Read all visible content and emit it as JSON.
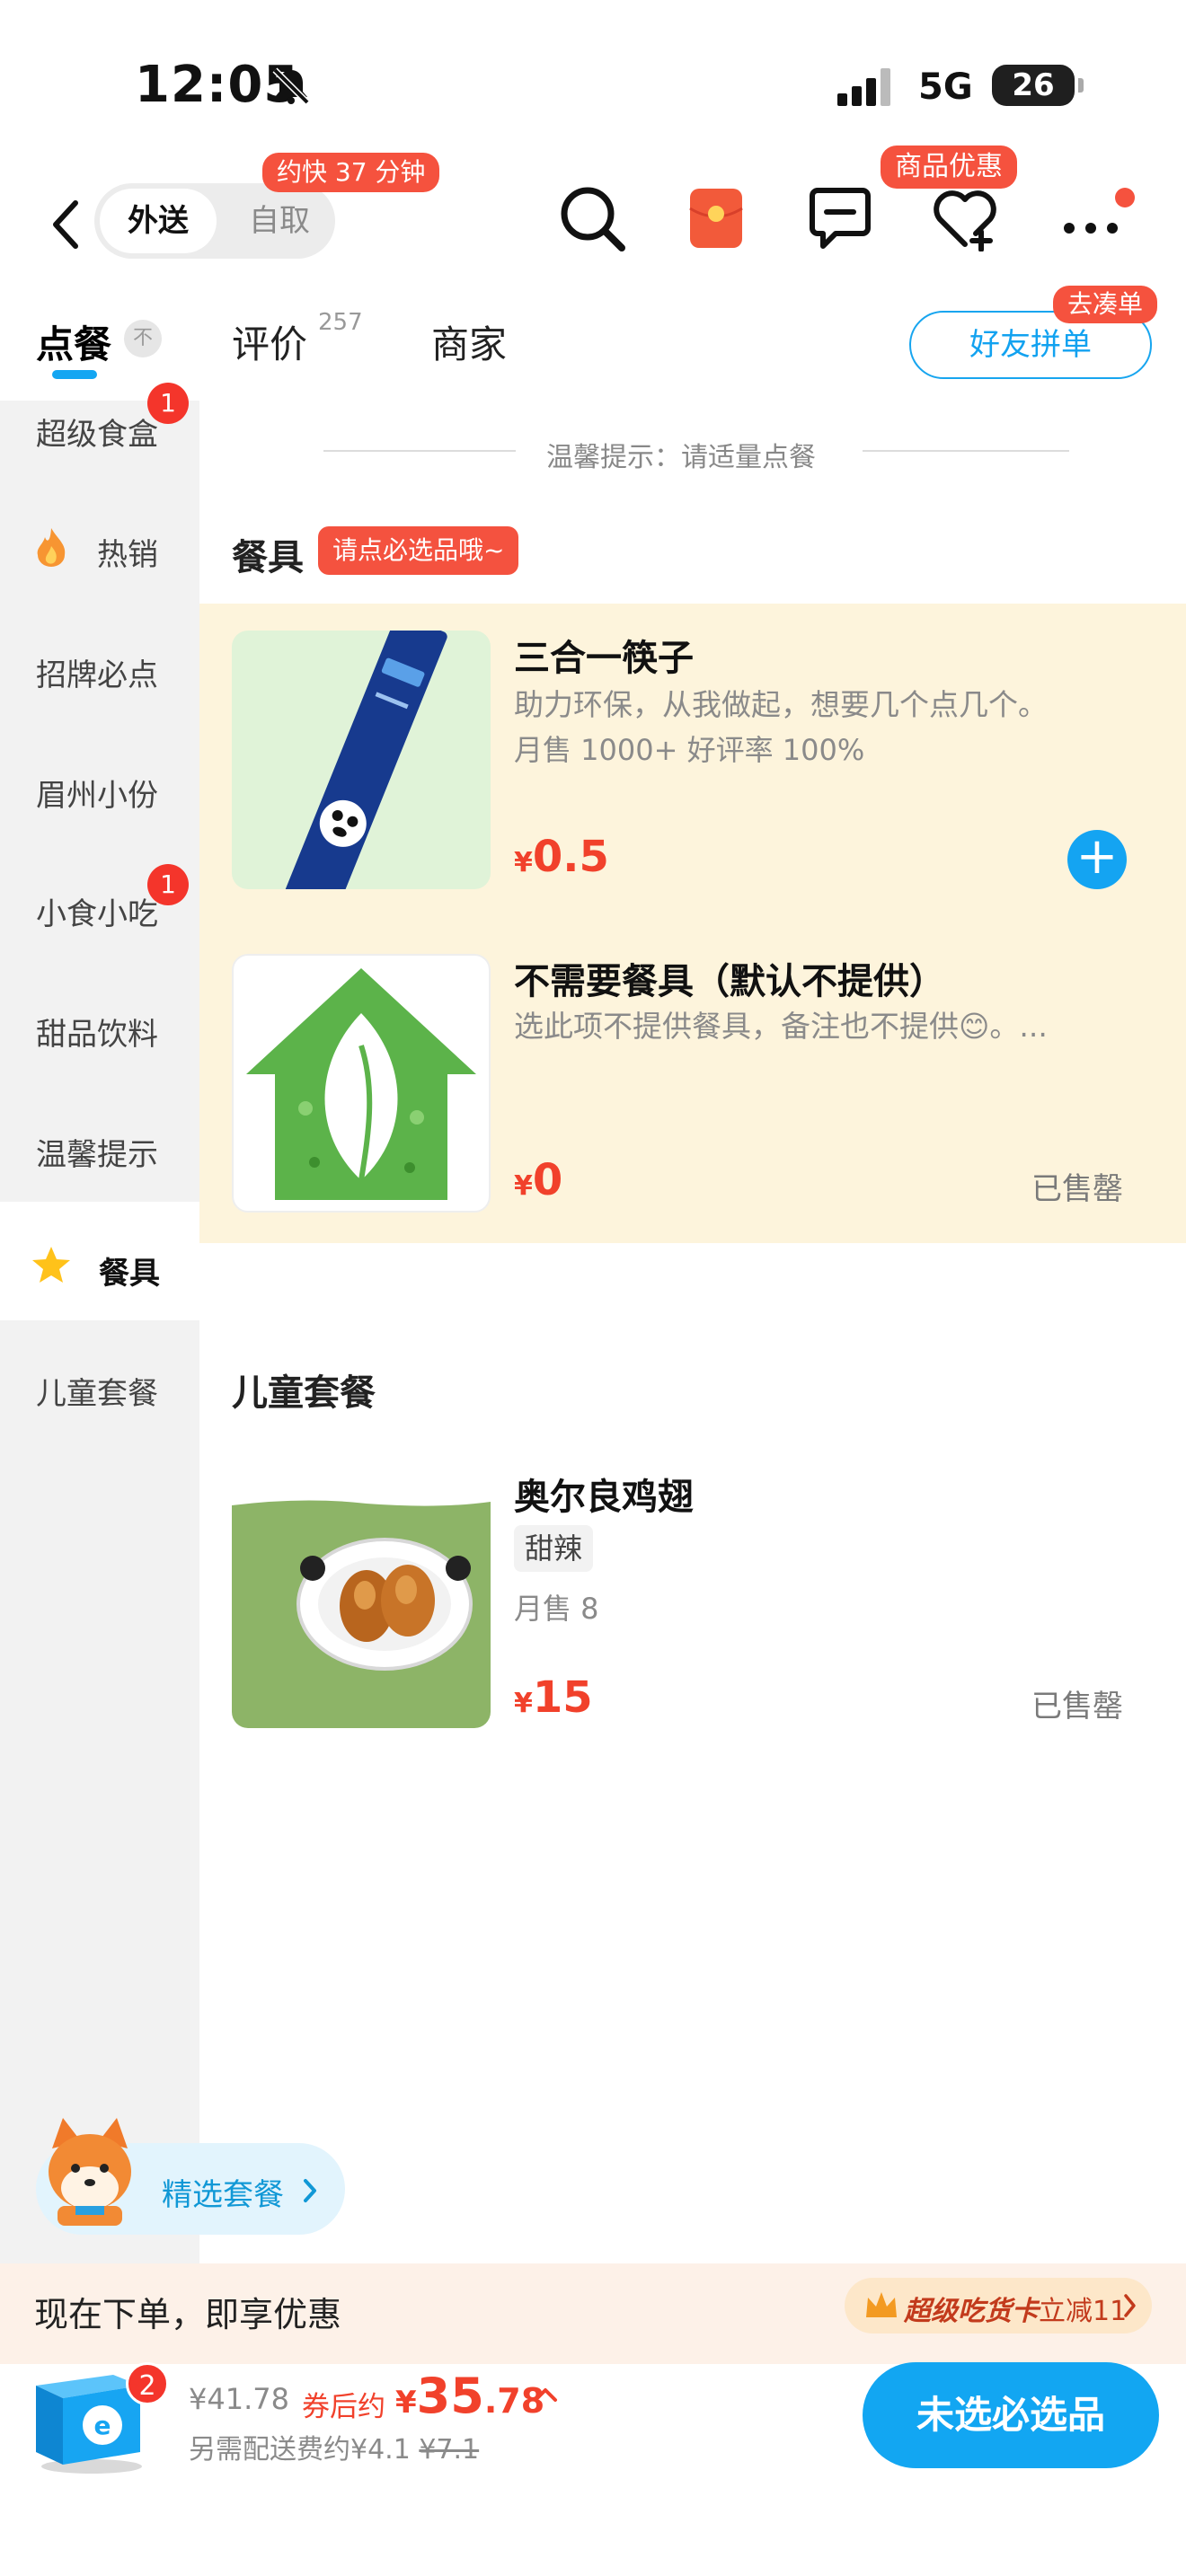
{
  "status_bar": {
    "time": "12:05",
    "carrier": "5G",
    "battery": "26"
  },
  "header": {
    "delivery_tab": "外送",
    "pickup_tab": "自取",
    "eta_bubble": "约快 37 分钟",
    "coupon_bubble": "商品优惠"
  },
  "tabs": {
    "order": "点餐",
    "reviews": "评价",
    "reviews_count": "257",
    "merchant": "商家",
    "collapse_glyph": "不"
  },
  "group_order": {
    "label": "好友拼单",
    "bubble": "去凑单"
  },
  "sidebar": {
    "items": [
      {
        "label": "超级食盒",
        "badge": "1"
      },
      {
        "label": "热销"
      },
      {
        "label": "招牌必点"
      },
      {
        "label": "眉州小份"
      },
      {
        "label": "小食小吃",
        "badge": "1"
      },
      {
        "label": "甜品饮料"
      },
      {
        "label": "温馨提示"
      },
      {
        "label": "餐具"
      },
      {
        "label": "儿童套餐"
      }
    ]
  },
  "main": {
    "hint": "温馨提示：请适量点餐",
    "tableware": {
      "title": "餐具",
      "tag": "请点必选品哦~",
      "products": [
        {
          "name": "三合一筷子",
          "desc": "助力环保，从我做起，想要几个点几个。",
          "sales": "月售 1000+ 好评率 100%",
          "currency": "¥",
          "price": "0.5",
          "add": "+"
        },
        {
          "name": "不需要餐具（默认不提供）",
          "desc": "选此项不提供餐具，备注也不提供😊。...",
          "currency": "¥",
          "price": "0",
          "status": "已售罄"
        }
      ]
    },
    "kids": {
      "title": "儿童套餐",
      "products": [
        {
          "name": "奥尔良鸡翅",
          "tag": "甜辣",
          "sales": "月售 8",
          "currency": "¥",
          "price": "15",
          "status": "已售罄"
        }
      ]
    }
  },
  "floating": {
    "combo_label": "精选套餐"
  },
  "promo": {
    "text": "现在下单，即享优惠",
    "card_brand": "超级吃货卡",
    "card_offer": "立减11"
  },
  "cart": {
    "badge": "2",
    "original_price": "¥41.78",
    "after_coupon_label": "券后约",
    "currency": "¥",
    "final_price_int": "35",
    "final_price_dec": ".78",
    "delivery_fee": "另需配送费约¥4.1",
    "delivery_fee_orig": "¥7.1",
    "checkout_label": "未选必选品"
  },
  "colors": {
    "accent": "#14A4F2",
    "price": "#F1412B",
    "badge": "#F4352B",
    "panel": "#FDF4DC"
  }
}
